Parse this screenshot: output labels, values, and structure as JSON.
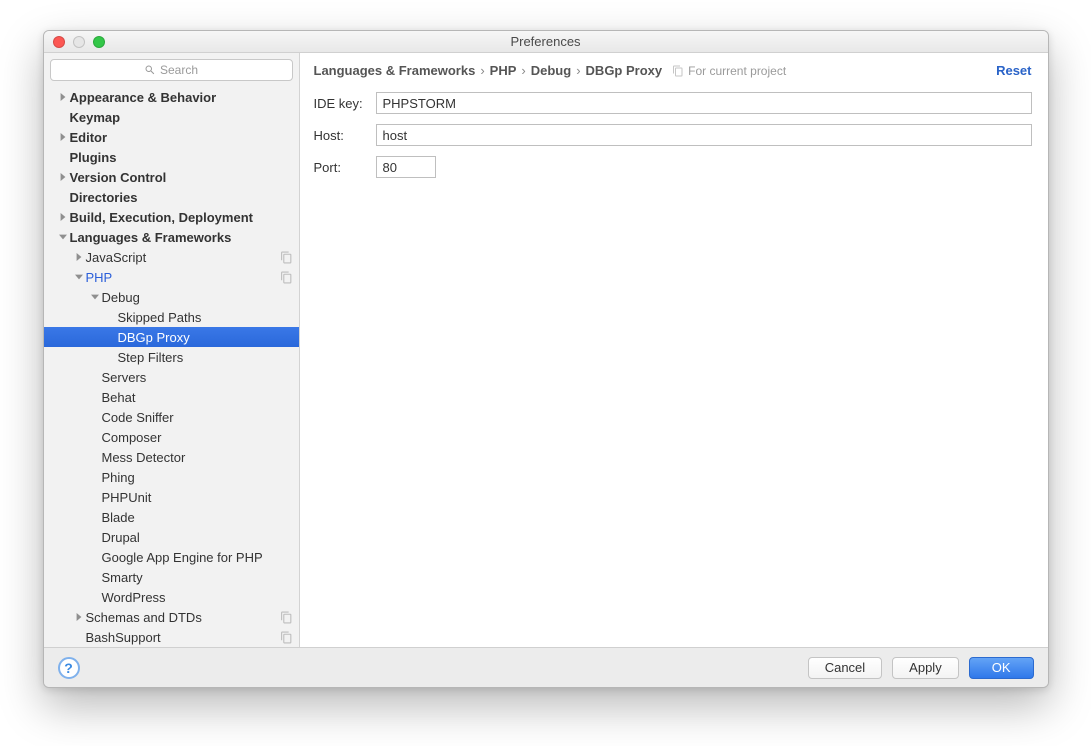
{
  "window": {
    "title": "Preferences"
  },
  "sidebar": {
    "search_placeholder": "Search",
    "items": [
      {
        "label": "Appearance & Behavior",
        "level": 0,
        "arrow": "right",
        "bold": true
      },
      {
        "label": "Keymap",
        "level": 0,
        "arrow": "",
        "bold": true
      },
      {
        "label": "Editor",
        "level": 0,
        "arrow": "right",
        "bold": true
      },
      {
        "label": "Plugins",
        "level": 0,
        "arrow": "",
        "bold": true
      },
      {
        "label": "Version Control",
        "level": 0,
        "arrow": "right",
        "bold": true
      },
      {
        "label": "Directories",
        "level": 0,
        "arrow": "",
        "bold": true
      },
      {
        "label": "Build, Execution, Deployment",
        "level": 0,
        "arrow": "right",
        "bold": true
      },
      {
        "label": "Languages & Frameworks",
        "level": 0,
        "arrow": "down",
        "bold": true
      },
      {
        "label": "JavaScript",
        "level": 1,
        "arrow": "right",
        "bold": false,
        "badge": true
      },
      {
        "label": "PHP",
        "level": 1,
        "arrow": "down",
        "bold": false,
        "php": true,
        "badge": true
      },
      {
        "label": "Debug",
        "level": 2,
        "arrow": "down",
        "bold": false
      },
      {
        "label": "Skipped Paths",
        "level": 3,
        "arrow": "",
        "bold": false
      },
      {
        "label": "DBGp Proxy",
        "level": 3,
        "arrow": "",
        "bold": false,
        "selected": true
      },
      {
        "label": "Step Filters",
        "level": 3,
        "arrow": "",
        "bold": false
      },
      {
        "label": "Servers",
        "level": 2,
        "arrow": "",
        "bold": false
      },
      {
        "label": "Behat",
        "level": 2,
        "arrow": "",
        "bold": false
      },
      {
        "label": "Code Sniffer",
        "level": 2,
        "arrow": "",
        "bold": false
      },
      {
        "label": "Composer",
        "level": 2,
        "arrow": "",
        "bold": false
      },
      {
        "label": "Mess Detector",
        "level": 2,
        "arrow": "",
        "bold": false
      },
      {
        "label": "Phing",
        "level": 2,
        "arrow": "",
        "bold": false
      },
      {
        "label": "PHPUnit",
        "level": 2,
        "arrow": "",
        "bold": false
      },
      {
        "label": "Blade",
        "level": 2,
        "arrow": "",
        "bold": false
      },
      {
        "label": "Drupal",
        "level": 2,
        "arrow": "",
        "bold": false
      },
      {
        "label": "Google App Engine for PHP",
        "level": 2,
        "arrow": "",
        "bold": false
      },
      {
        "label": "Smarty",
        "level": 2,
        "arrow": "",
        "bold": false
      },
      {
        "label": "WordPress",
        "level": 2,
        "arrow": "",
        "bold": false
      },
      {
        "label": "Schemas and DTDs",
        "level": 1,
        "arrow": "right",
        "bold": false,
        "badge": true
      },
      {
        "label": "BashSupport",
        "level": 1,
        "arrow": "",
        "bold": false,
        "badge": true
      }
    ]
  },
  "breadcrumb": {
    "parts": [
      "Languages & Frameworks",
      "PHP",
      "Debug",
      "DBGp Proxy"
    ],
    "scope": "For current project",
    "reset": "Reset"
  },
  "form": {
    "ide_key_label": "IDE key:",
    "ide_key_value": "PHPSTORM",
    "host_label": "Host:",
    "host_value": "host",
    "port_label": "Port:",
    "port_value": "80"
  },
  "footer": {
    "cancel": "Cancel",
    "apply": "Apply",
    "ok": "OK"
  }
}
